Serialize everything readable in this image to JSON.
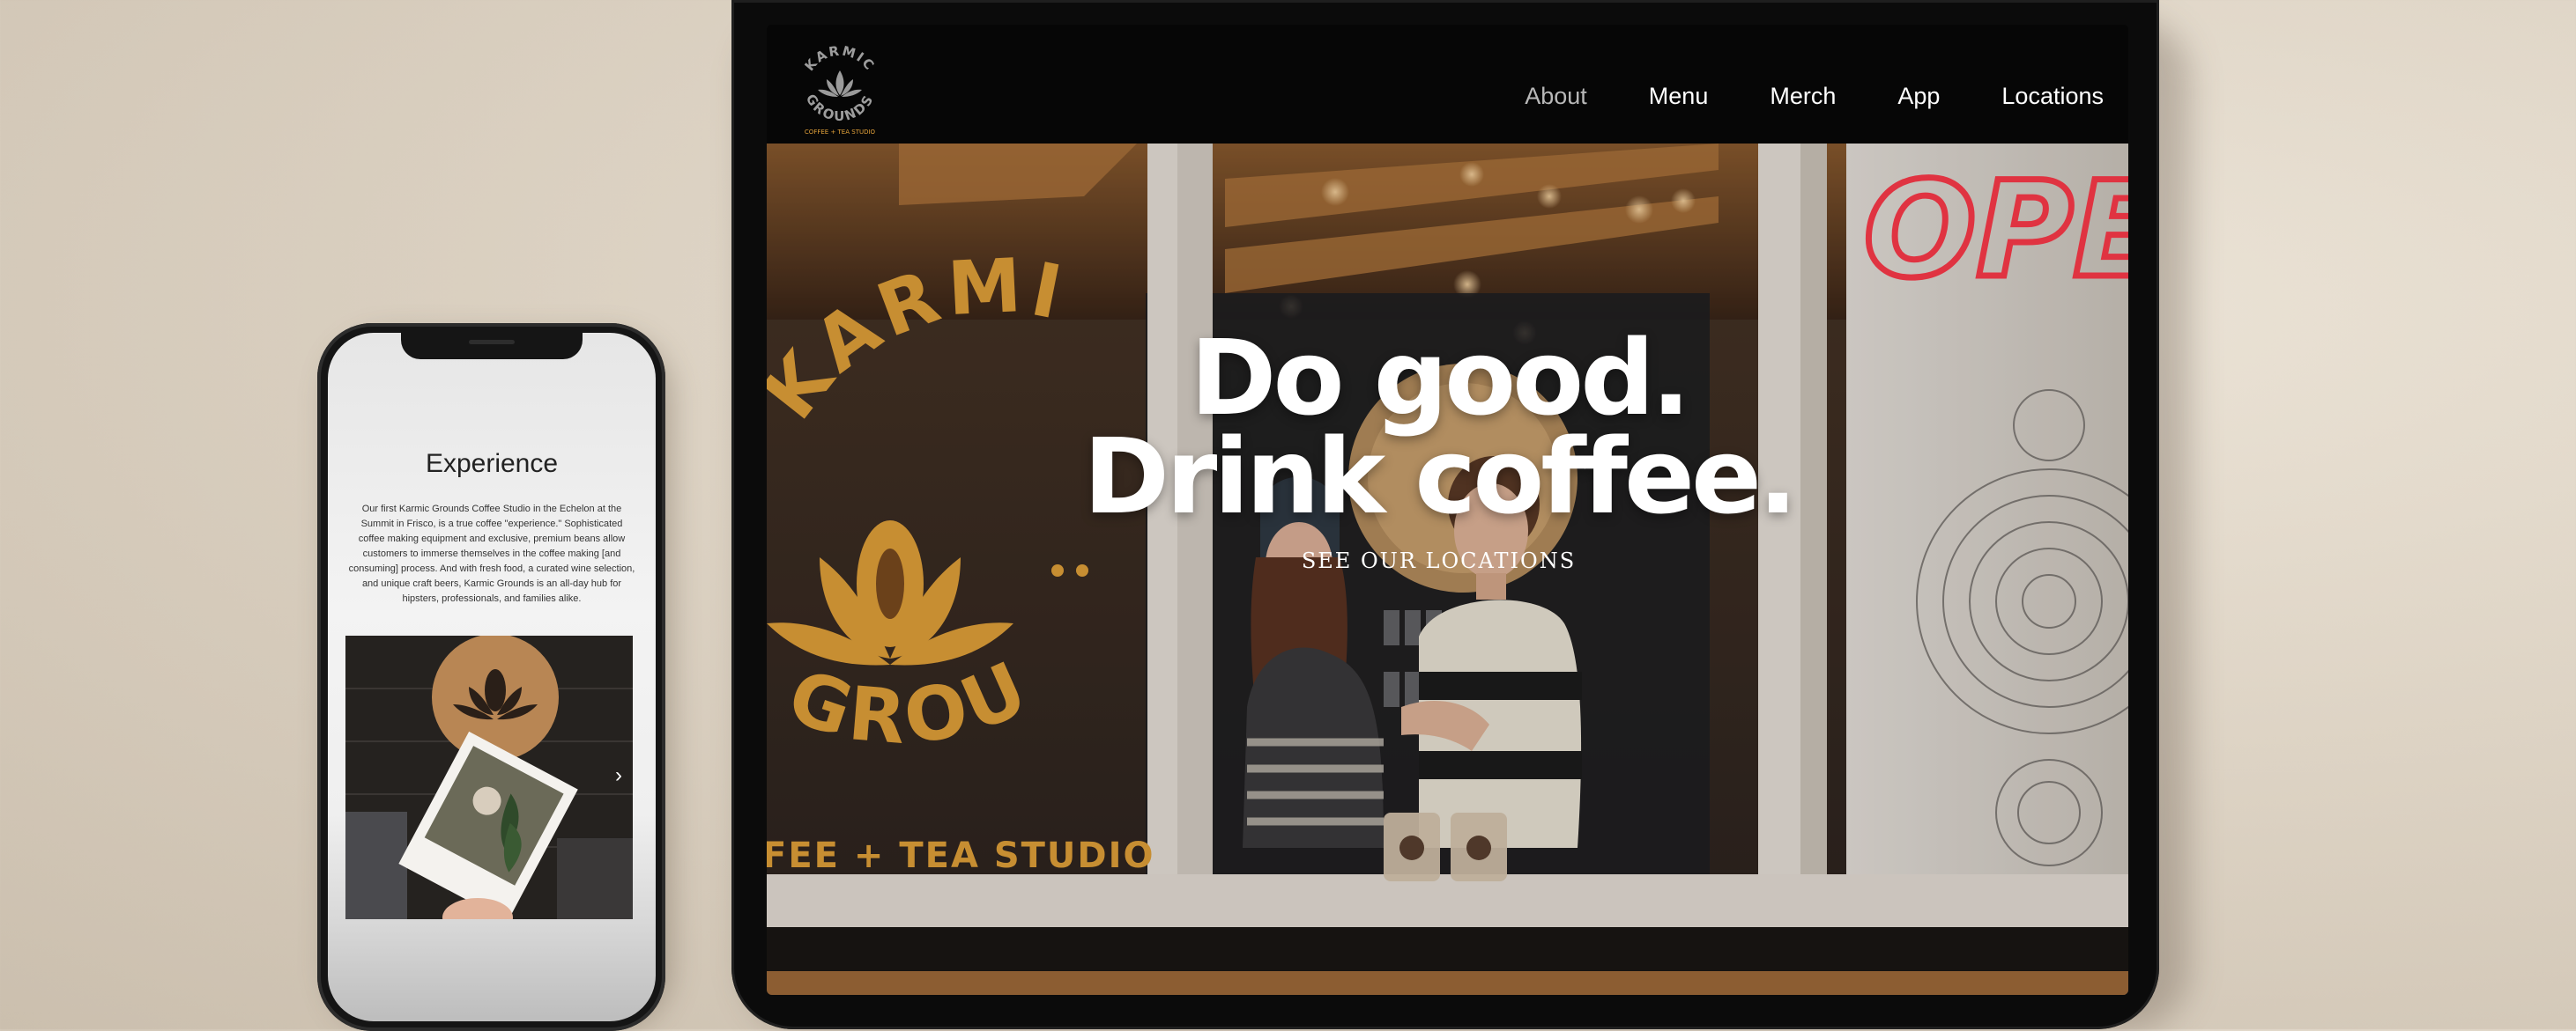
{
  "tablet": {
    "logo": {
      "top_text": "KARMIC",
      "bottom_text": "GROUNDS",
      "tagline": "COFFEE + TEA STUDIO"
    },
    "nav": [
      {
        "label": "About",
        "active": true
      },
      {
        "label": "Menu"
      },
      {
        "label": "Merch"
      },
      {
        "label": "App"
      },
      {
        "label": "Locations"
      }
    ],
    "hero": {
      "headline_line1": "Do good.",
      "headline_line2": "Drink coffee.",
      "cta": "SEE OUR LOCATIONS",
      "window_sign_top": "KARMIC",
      "window_sign_bottom": "GROUNDS",
      "window_sign_tagline": "FEE + TEA STUDIO",
      "neon_sign": "OPE"
    }
  },
  "phone": {
    "title": "Experience",
    "body": "Our first Karmic Grounds Coffee Studio in the Echelon at the Summit in Frisco, is a true coffee \"experience.\" Sophisticated coffee making equipment and exclusive, premium beans allow customers to immerse themselves in the coffee making [and consuming] process. And with fresh food, a curated wine selection, and unique craft beers, Karmic Grounds is an all-day hub for hipsters, professionals, and families alike.",
    "carousel_next": "›"
  },
  "colors": {
    "brand_gold": "#e3a23a",
    "neon_red": "#ff3b4a",
    "nav_active": "#b8b8b8",
    "background": "#ddd3c4"
  }
}
